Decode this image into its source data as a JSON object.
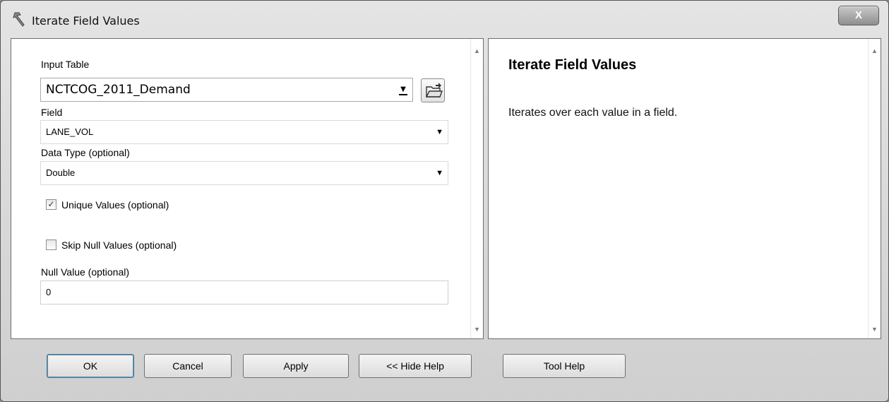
{
  "window": {
    "title": "Iterate Field Values",
    "close_label": "X"
  },
  "params": {
    "input_table": {
      "label": "Input Table",
      "value": "NCTCOG_2011_Demand"
    },
    "field": {
      "label": "Field",
      "value": "LANE_VOL"
    },
    "data_type": {
      "label": "Data Type (optional)",
      "value": "Double"
    },
    "unique_values": {
      "label": "Unique Values (optional)",
      "checked": true,
      "mark": "✓"
    },
    "skip_null": {
      "label": "Skip Null Values (optional)",
      "checked": false
    },
    "null_value": {
      "label": "Null Value (optional)",
      "value": "0"
    }
  },
  "help": {
    "title": "Iterate Field Values",
    "description": "Iterates over each value in a field."
  },
  "buttons": {
    "ok": "OK",
    "cancel": "Cancel",
    "apply": "Apply",
    "hide_help": "<< Hide Help",
    "tool_help": "Tool Help"
  }
}
